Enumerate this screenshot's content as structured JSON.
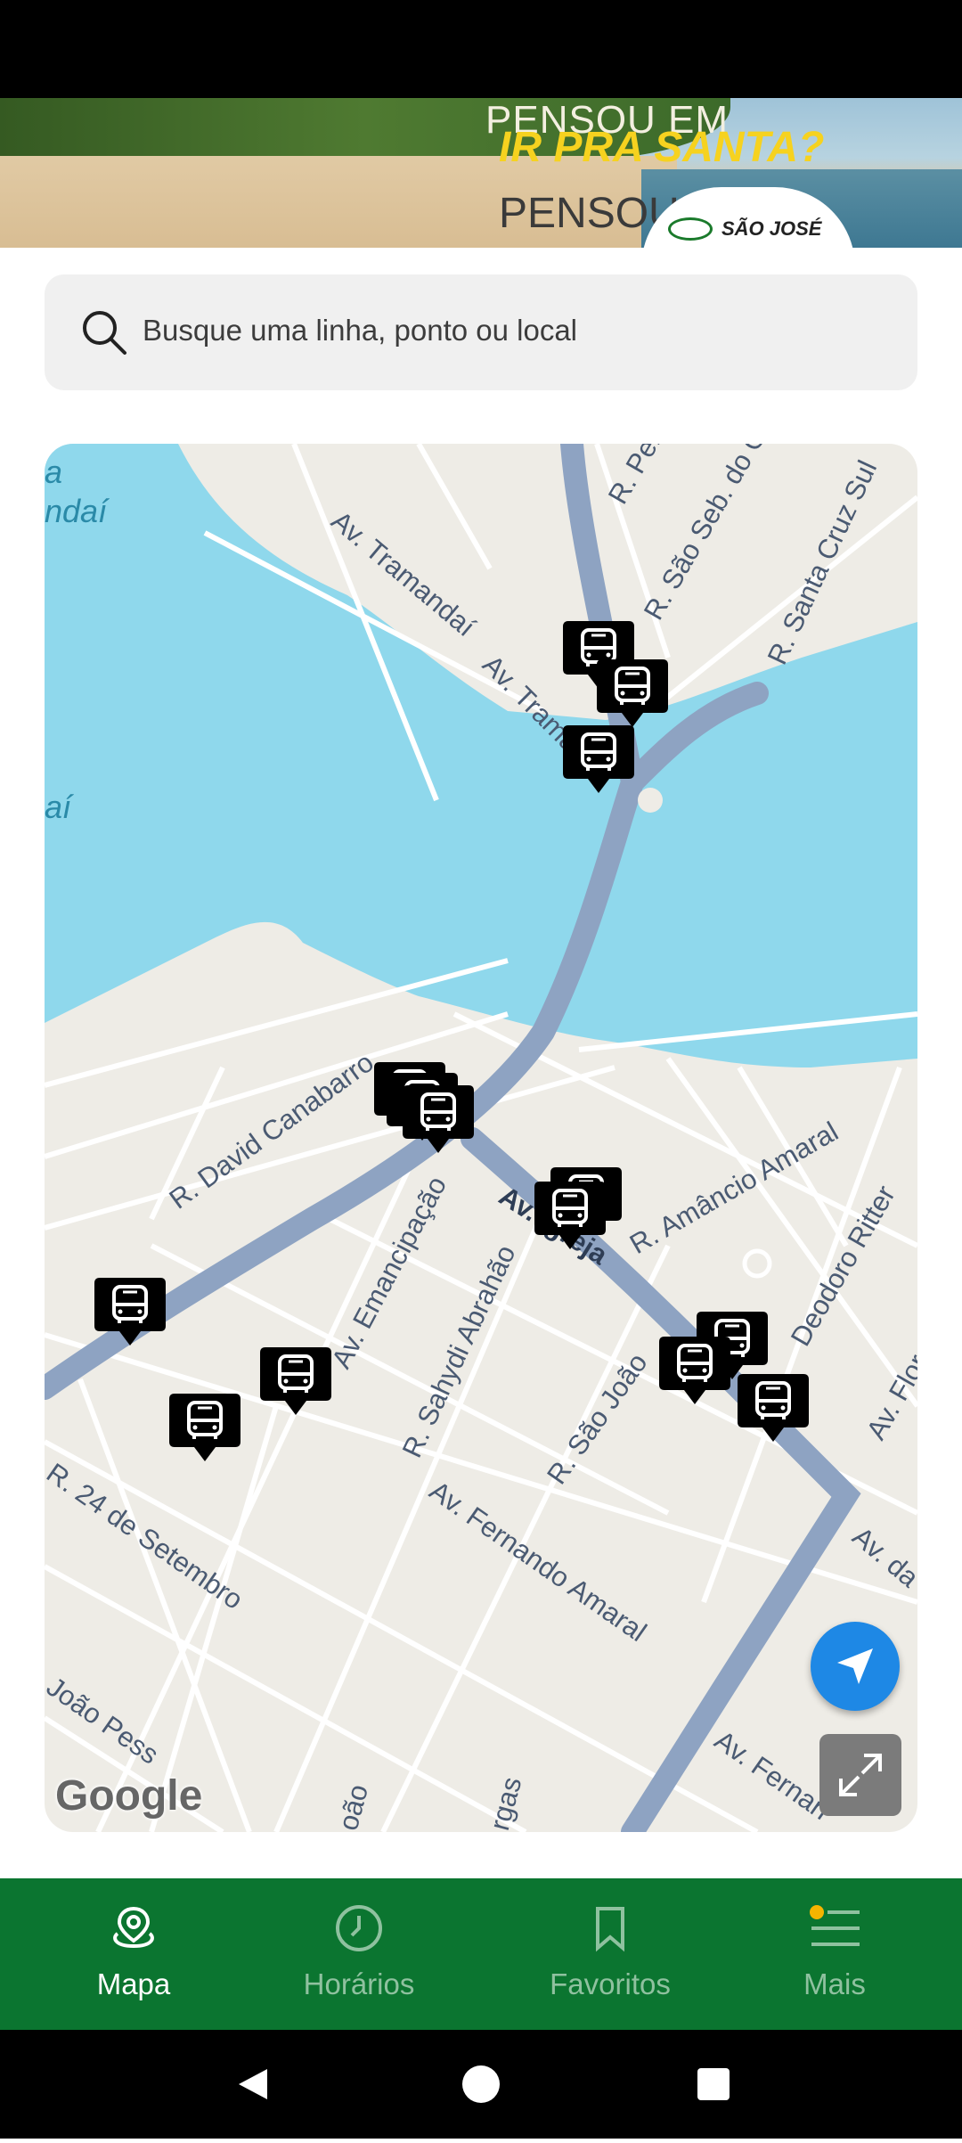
{
  "banner": {
    "line1": "PENSOU EM",
    "line2": "IR PRA SANTA?",
    "line3": "PENSOU",
    "brand": "SÃO JOSÉ"
  },
  "search": {
    "placeholder": "Busque uma linha, ponto ou local"
  },
  "map": {
    "streets": [
      "R. Pel",
      "R. São Seb. do Ca",
      "R. Santa Cruz Sul",
      "Av. Tramandaí",
      "Av. Trama",
      "R. David Canabarro",
      "Av. Emancipação",
      "Av. Igreja",
      "R. Amâncio Amaral",
      "Deodoro Ritter",
      "R. Sahydi Abrahão",
      "R. São João",
      "Av. Flor",
      "R. 24 de Setembro",
      "Av. Fernando Amaral",
      "Av. da",
      "João Pess",
      "oão",
      "rgas",
      "Av. Fernan",
      "ndaí",
      "aí",
      "a"
    ],
    "attribution": "Google"
  },
  "nav": {
    "items": [
      {
        "label": "Mapa",
        "icon": "map-pin-icon",
        "active": true
      },
      {
        "label": "Horários",
        "icon": "clock-icon",
        "active": false
      },
      {
        "label": "Favoritos",
        "icon": "bookmark-icon",
        "active": false
      },
      {
        "label": "Mais",
        "icon": "menu-icon",
        "active": false
      }
    ]
  },
  "colors": {
    "nav_bg": "#0b7530",
    "water": "#8fd8ec",
    "road": "#8ea3c2",
    "locate": "#1e88e5"
  }
}
